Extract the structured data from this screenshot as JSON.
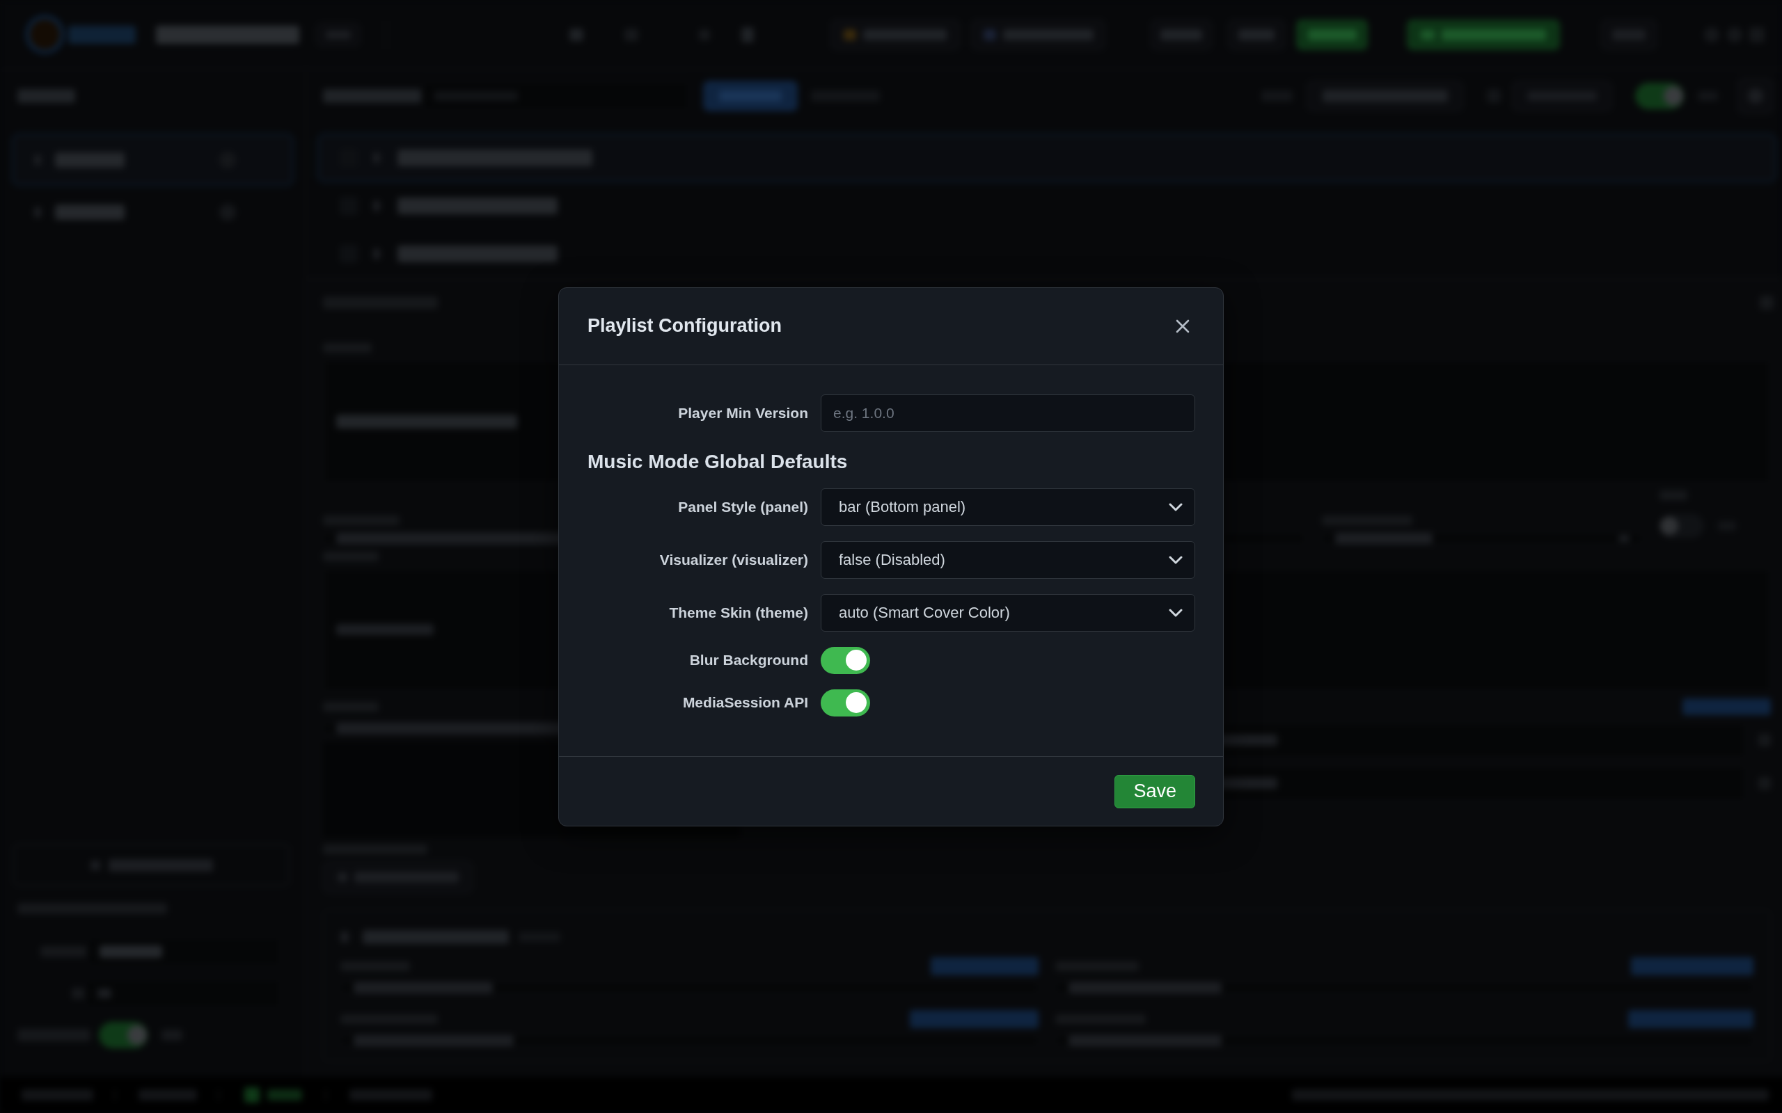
{
  "dialog": {
    "title": "Playlist Configuration",
    "fields": [
      {
        "kind": "text",
        "label": "Player Min Version",
        "placeholder": "e.g. 1.0.0"
      }
    ],
    "section": {
      "title": "Music Mode Global Defaults",
      "fields": [
        {
          "kind": "select",
          "label": "Panel Style (panel)",
          "value": "bar (Bottom panel)"
        },
        {
          "kind": "select",
          "label": "Visualizer (visualizer)",
          "value": "false (Disabled)"
        },
        {
          "kind": "select",
          "label": "Theme Skin (theme)",
          "value": "auto (Smart Cover Color)"
        },
        {
          "kind": "toggle",
          "label": "Blur Background",
          "on": true
        },
        {
          "kind": "toggle",
          "label": "MediaSession API",
          "on": true
        }
      ]
    },
    "buttons": [
      "Save"
    ]
  }
}
